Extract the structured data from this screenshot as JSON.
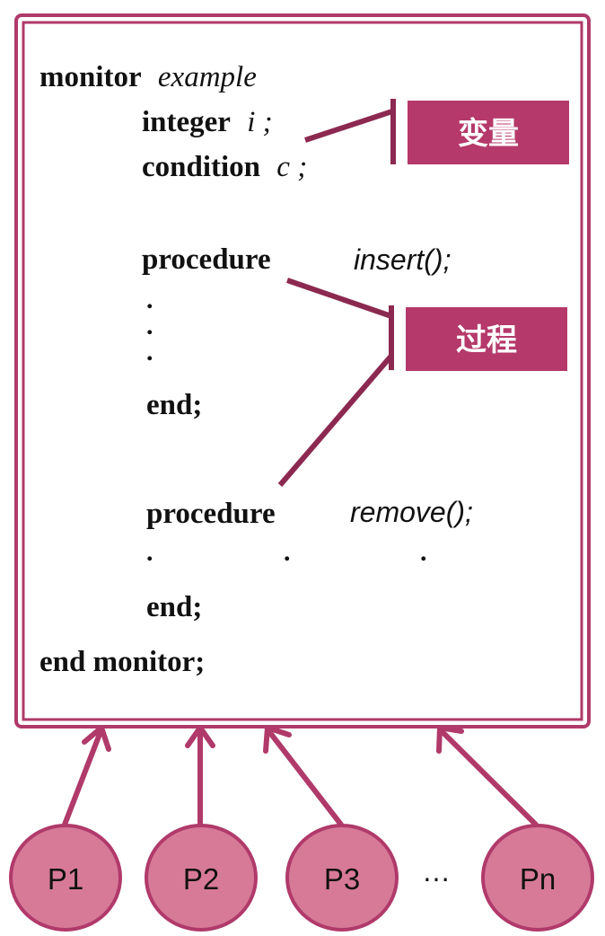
{
  "code": {
    "monitor_kw": "monitor",
    "monitor_name": "example",
    "integer_kw": "integer",
    "integer_var": "i",
    "integer_semi": ";",
    "condition_kw": "condition",
    "condition_var": "c",
    "condition_semi": ";",
    "procedure1_kw": "procedure",
    "procedure1_name": "insert();",
    "procedure1_dots": [
      ".",
      ".",
      "."
    ],
    "end1": "end;",
    "procedure2_kw": "procedure",
    "procedure2_name": "remove();",
    "procedure2_dots": [
      ".",
      ".",
      "."
    ],
    "end2": "end;",
    "end_monitor": "end monitor;"
  },
  "tags": {
    "variables": "变量",
    "procedures": "过程"
  },
  "processes": {
    "items": [
      "P1",
      "P2",
      "P3",
      "Pn"
    ],
    "ellipsis": "…"
  },
  "colors": {
    "border": "#b03a6a",
    "connector": "#8c2950",
    "tag_fill": "#b5396a",
    "process_fill": "#d77a98",
    "process_stroke": "#b03a6a"
  }
}
